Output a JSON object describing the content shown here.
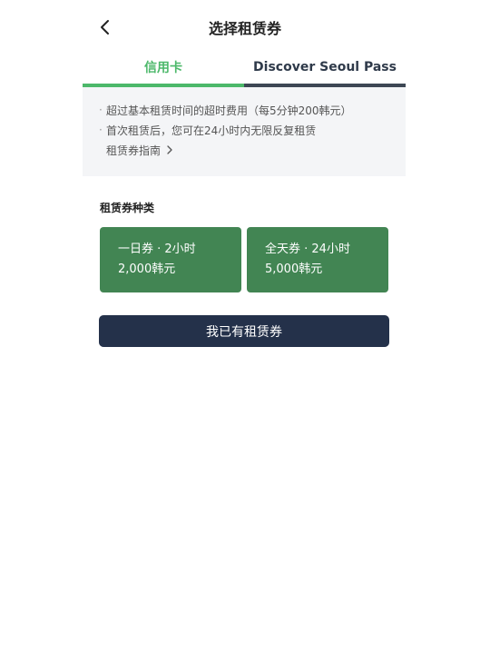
{
  "header": {
    "title": "选择租赁券",
    "back_icon": "chevron-left-icon"
  },
  "tabs": [
    {
      "label": "信用卡",
      "active": true
    },
    {
      "label": "Discover Seoul Pass",
      "active": false
    }
  ],
  "info": {
    "lines": [
      "超过基本租赁时间的超时费用（每5分钟200韩元）",
      "首次租赁后，您可在24小时内无限反复租赁"
    ],
    "guide_link": "租赁券指南",
    "guide_icon": "chevron-right-icon"
  },
  "section": {
    "title": "租赁券种类"
  },
  "passes": [
    {
      "name": "一日券 · 2小时",
      "price": "2,000韩元"
    },
    {
      "name": "全天券 · 24小时",
      "price": "5,000韩元"
    }
  ],
  "colors": {
    "accent_green": "#4cb86a",
    "card_green": "#428553",
    "button_navy": "#24314a"
  },
  "actions": {
    "have_pass_label": "我已有租赁券"
  }
}
